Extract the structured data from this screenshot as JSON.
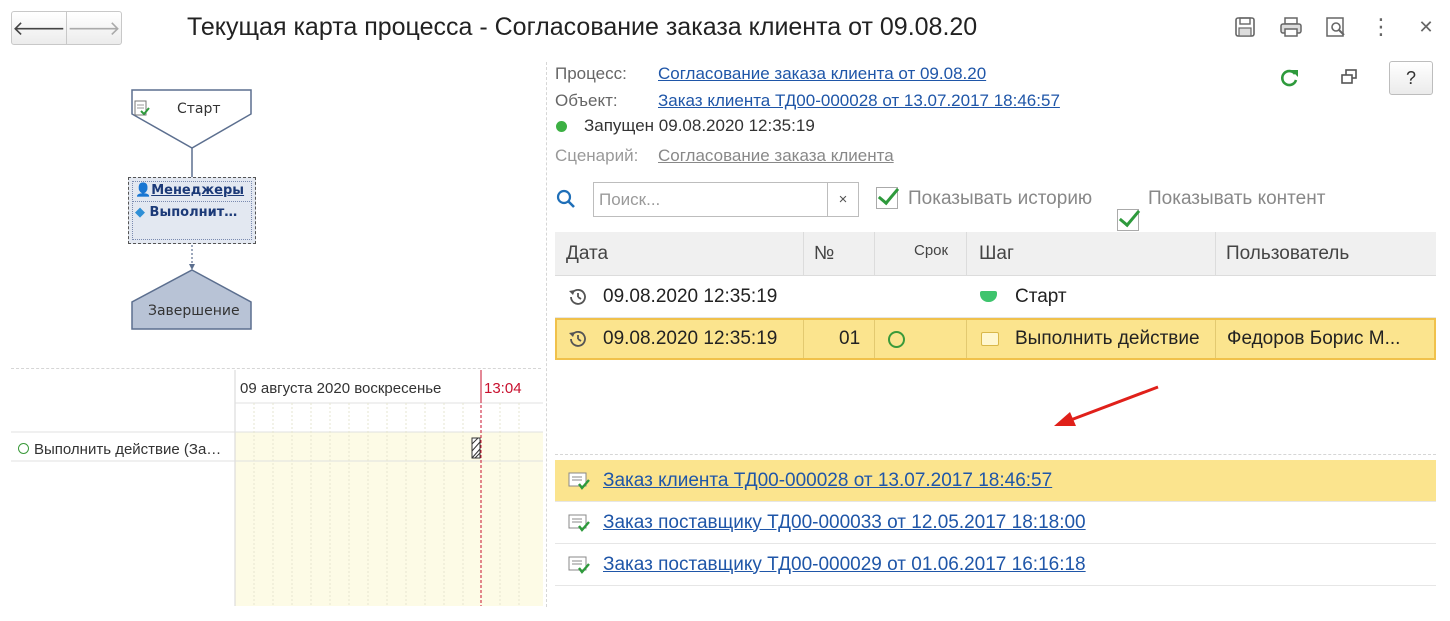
{
  "window": {
    "title": "Текущая карта процесса - Согласование заказа клиента от 09.08.20"
  },
  "flowchart": {
    "start_label": "Старт",
    "task_group_label": "Менеджеры",
    "task_label": "Выполнит…",
    "end_label": "Завершение"
  },
  "gantt": {
    "date_header": "09 августа 2020 воскресенье",
    "time_marker": "13:04",
    "task_label": "Выполнить действие (За…"
  },
  "info": {
    "process_label": "Процесс:",
    "process_value": "Согласование заказа клиента от 09.08.20",
    "object_label": "Объект:",
    "object_value": "Заказ клиента ТД00-000028 от 13.07.2017 18:46:57",
    "status_text": "Запущен 09.08.2020 12:35:19",
    "scenario_label": "Сценарий:",
    "scenario_value": "Согласование заказа клиента",
    "status_color": "#3cb043"
  },
  "toolbar": {
    "help_label": "?"
  },
  "search": {
    "placeholder": "Поиск...",
    "value": "",
    "clear_label": "×"
  },
  "options": {
    "show_history_label": "Показывать историю",
    "show_history_checked": true,
    "show_content_label": "Показывать контент",
    "show_content_checked": true
  },
  "table": {
    "columns": [
      "Дата",
      "№",
      "Срок",
      "Шаг",
      "Пользователь"
    ],
    "rows": [
      {
        "date": "09.08.2020 12:35:19",
        "num": "",
        "deadline": "",
        "step": "Старт",
        "user": "",
        "selected": false
      },
      {
        "date": "09.08.2020 12:35:19",
        "num": "01",
        "deadline": "",
        "step": "Выполнить действие",
        "user": "Федоров Борис М...",
        "selected": true
      }
    ]
  },
  "content_list": [
    {
      "label": "Заказ клиента ТД00-000028 от 13.07.2017 18:46:57",
      "selected": true
    },
    {
      "label": "Заказ поставщику ТД00-000033 от 12.05.2017 18:18:00",
      "selected": false
    },
    {
      "label": "Заказ поставщику ТД00-000029 от 01.06.2017 16:16:18",
      "selected": false
    }
  ],
  "colors": {
    "selection": "#fbe48e",
    "link": "#1f56a8",
    "annotation_arrow": "#e0201a"
  }
}
